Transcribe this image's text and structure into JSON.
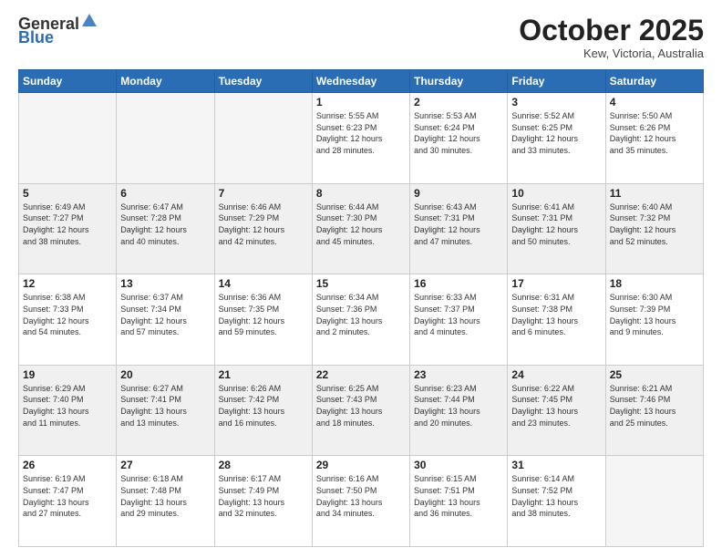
{
  "header": {
    "logo_general": "General",
    "logo_blue": "Blue",
    "month": "October 2025",
    "location": "Kew, Victoria, Australia"
  },
  "days_of_week": [
    "Sunday",
    "Monday",
    "Tuesday",
    "Wednesday",
    "Thursday",
    "Friday",
    "Saturday"
  ],
  "weeks": [
    [
      {
        "day": "",
        "info": ""
      },
      {
        "day": "",
        "info": ""
      },
      {
        "day": "",
        "info": ""
      },
      {
        "day": "1",
        "info": "Sunrise: 5:55 AM\nSunset: 6:23 PM\nDaylight: 12 hours\nand 28 minutes."
      },
      {
        "day": "2",
        "info": "Sunrise: 5:53 AM\nSunset: 6:24 PM\nDaylight: 12 hours\nand 30 minutes."
      },
      {
        "day": "3",
        "info": "Sunrise: 5:52 AM\nSunset: 6:25 PM\nDaylight: 12 hours\nand 33 minutes."
      },
      {
        "day": "4",
        "info": "Sunrise: 5:50 AM\nSunset: 6:26 PM\nDaylight: 12 hours\nand 35 minutes."
      }
    ],
    [
      {
        "day": "5",
        "info": "Sunrise: 6:49 AM\nSunset: 7:27 PM\nDaylight: 12 hours\nand 38 minutes."
      },
      {
        "day": "6",
        "info": "Sunrise: 6:47 AM\nSunset: 7:28 PM\nDaylight: 12 hours\nand 40 minutes."
      },
      {
        "day": "7",
        "info": "Sunrise: 6:46 AM\nSunset: 7:29 PM\nDaylight: 12 hours\nand 42 minutes."
      },
      {
        "day": "8",
        "info": "Sunrise: 6:44 AM\nSunset: 7:30 PM\nDaylight: 12 hours\nand 45 minutes."
      },
      {
        "day": "9",
        "info": "Sunrise: 6:43 AM\nSunset: 7:31 PM\nDaylight: 12 hours\nand 47 minutes."
      },
      {
        "day": "10",
        "info": "Sunrise: 6:41 AM\nSunset: 7:31 PM\nDaylight: 12 hours\nand 50 minutes."
      },
      {
        "day": "11",
        "info": "Sunrise: 6:40 AM\nSunset: 7:32 PM\nDaylight: 12 hours\nand 52 minutes."
      }
    ],
    [
      {
        "day": "12",
        "info": "Sunrise: 6:38 AM\nSunset: 7:33 PM\nDaylight: 12 hours\nand 54 minutes."
      },
      {
        "day": "13",
        "info": "Sunrise: 6:37 AM\nSunset: 7:34 PM\nDaylight: 12 hours\nand 57 minutes."
      },
      {
        "day": "14",
        "info": "Sunrise: 6:36 AM\nSunset: 7:35 PM\nDaylight: 12 hours\nand 59 minutes."
      },
      {
        "day": "15",
        "info": "Sunrise: 6:34 AM\nSunset: 7:36 PM\nDaylight: 13 hours\nand 2 minutes."
      },
      {
        "day": "16",
        "info": "Sunrise: 6:33 AM\nSunset: 7:37 PM\nDaylight: 13 hours\nand 4 minutes."
      },
      {
        "day": "17",
        "info": "Sunrise: 6:31 AM\nSunset: 7:38 PM\nDaylight: 13 hours\nand 6 minutes."
      },
      {
        "day": "18",
        "info": "Sunrise: 6:30 AM\nSunset: 7:39 PM\nDaylight: 13 hours\nand 9 minutes."
      }
    ],
    [
      {
        "day": "19",
        "info": "Sunrise: 6:29 AM\nSunset: 7:40 PM\nDaylight: 13 hours\nand 11 minutes."
      },
      {
        "day": "20",
        "info": "Sunrise: 6:27 AM\nSunset: 7:41 PM\nDaylight: 13 hours\nand 13 minutes."
      },
      {
        "day": "21",
        "info": "Sunrise: 6:26 AM\nSunset: 7:42 PM\nDaylight: 13 hours\nand 16 minutes."
      },
      {
        "day": "22",
        "info": "Sunrise: 6:25 AM\nSunset: 7:43 PM\nDaylight: 13 hours\nand 18 minutes."
      },
      {
        "day": "23",
        "info": "Sunrise: 6:23 AM\nSunset: 7:44 PM\nDaylight: 13 hours\nand 20 minutes."
      },
      {
        "day": "24",
        "info": "Sunrise: 6:22 AM\nSunset: 7:45 PM\nDaylight: 13 hours\nand 23 minutes."
      },
      {
        "day": "25",
        "info": "Sunrise: 6:21 AM\nSunset: 7:46 PM\nDaylight: 13 hours\nand 25 minutes."
      }
    ],
    [
      {
        "day": "26",
        "info": "Sunrise: 6:19 AM\nSunset: 7:47 PM\nDaylight: 13 hours\nand 27 minutes."
      },
      {
        "day": "27",
        "info": "Sunrise: 6:18 AM\nSunset: 7:48 PM\nDaylight: 13 hours\nand 29 minutes."
      },
      {
        "day": "28",
        "info": "Sunrise: 6:17 AM\nSunset: 7:49 PM\nDaylight: 13 hours\nand 32 minutes."
      },
      {
        "day": "29",
        "info": "Sunrise: 6:16 AM\nSunset: 7:50 PM\nDaylight: 13 hours\nand 34 minutes."
      },
      {
        "day": "30",
        "info": "Sunrise: 6:15 AM\nSunset: 7:51 PM\nDaylight: 13 hours\nand 36 minutes."
      },
      {
        "day": "31",
        "info": "Sunrise: 6:14 AM\nSunset: 7:52 PM\nDaylight: 13 hours\nand 38 minutes."
      },
      {
        "day": "",
        "info": ""
      }
    ]
  ]
}
